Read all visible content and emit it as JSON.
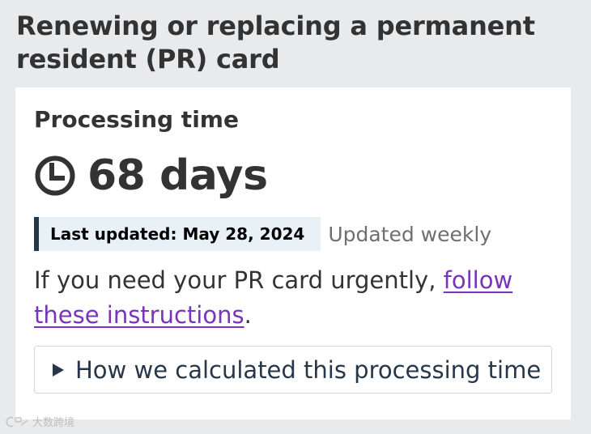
{
  "page": {
    "title": "Renewing or replacing a permanent resident (PR) card"
  },
  "processing": {
    "heading": "Processing time",
    "icon": "clock-icon",
    "value": "68 days",
    "updated_label": "Last updated:",
    "updated_date": "May 28, 2024",
    "frequency": "Updated weekly"
  },
  "urgent": {
    "text_before": "If you need your PR card urgently, ",
    "link_text": "follow these instructions",
    "text_after": "."
  },
  "details": {
    "icon": "triangle-right-icon",
    "summary": "How we calculated this processing time"
  },
  "watermark": {
    "text": "大数跨境"
  },
  "colors": {
    "page_background": "#e9eaec",
    "card_background": "#ffffff",
    "text": "#333333",
    "link": "#7834bc",
    "badge_background": "#e8f1f6",
    "badge_border": "#26374a",
    "details_text": "#26374a",
    "muted_text": "#6f6f6f"
  }
}
